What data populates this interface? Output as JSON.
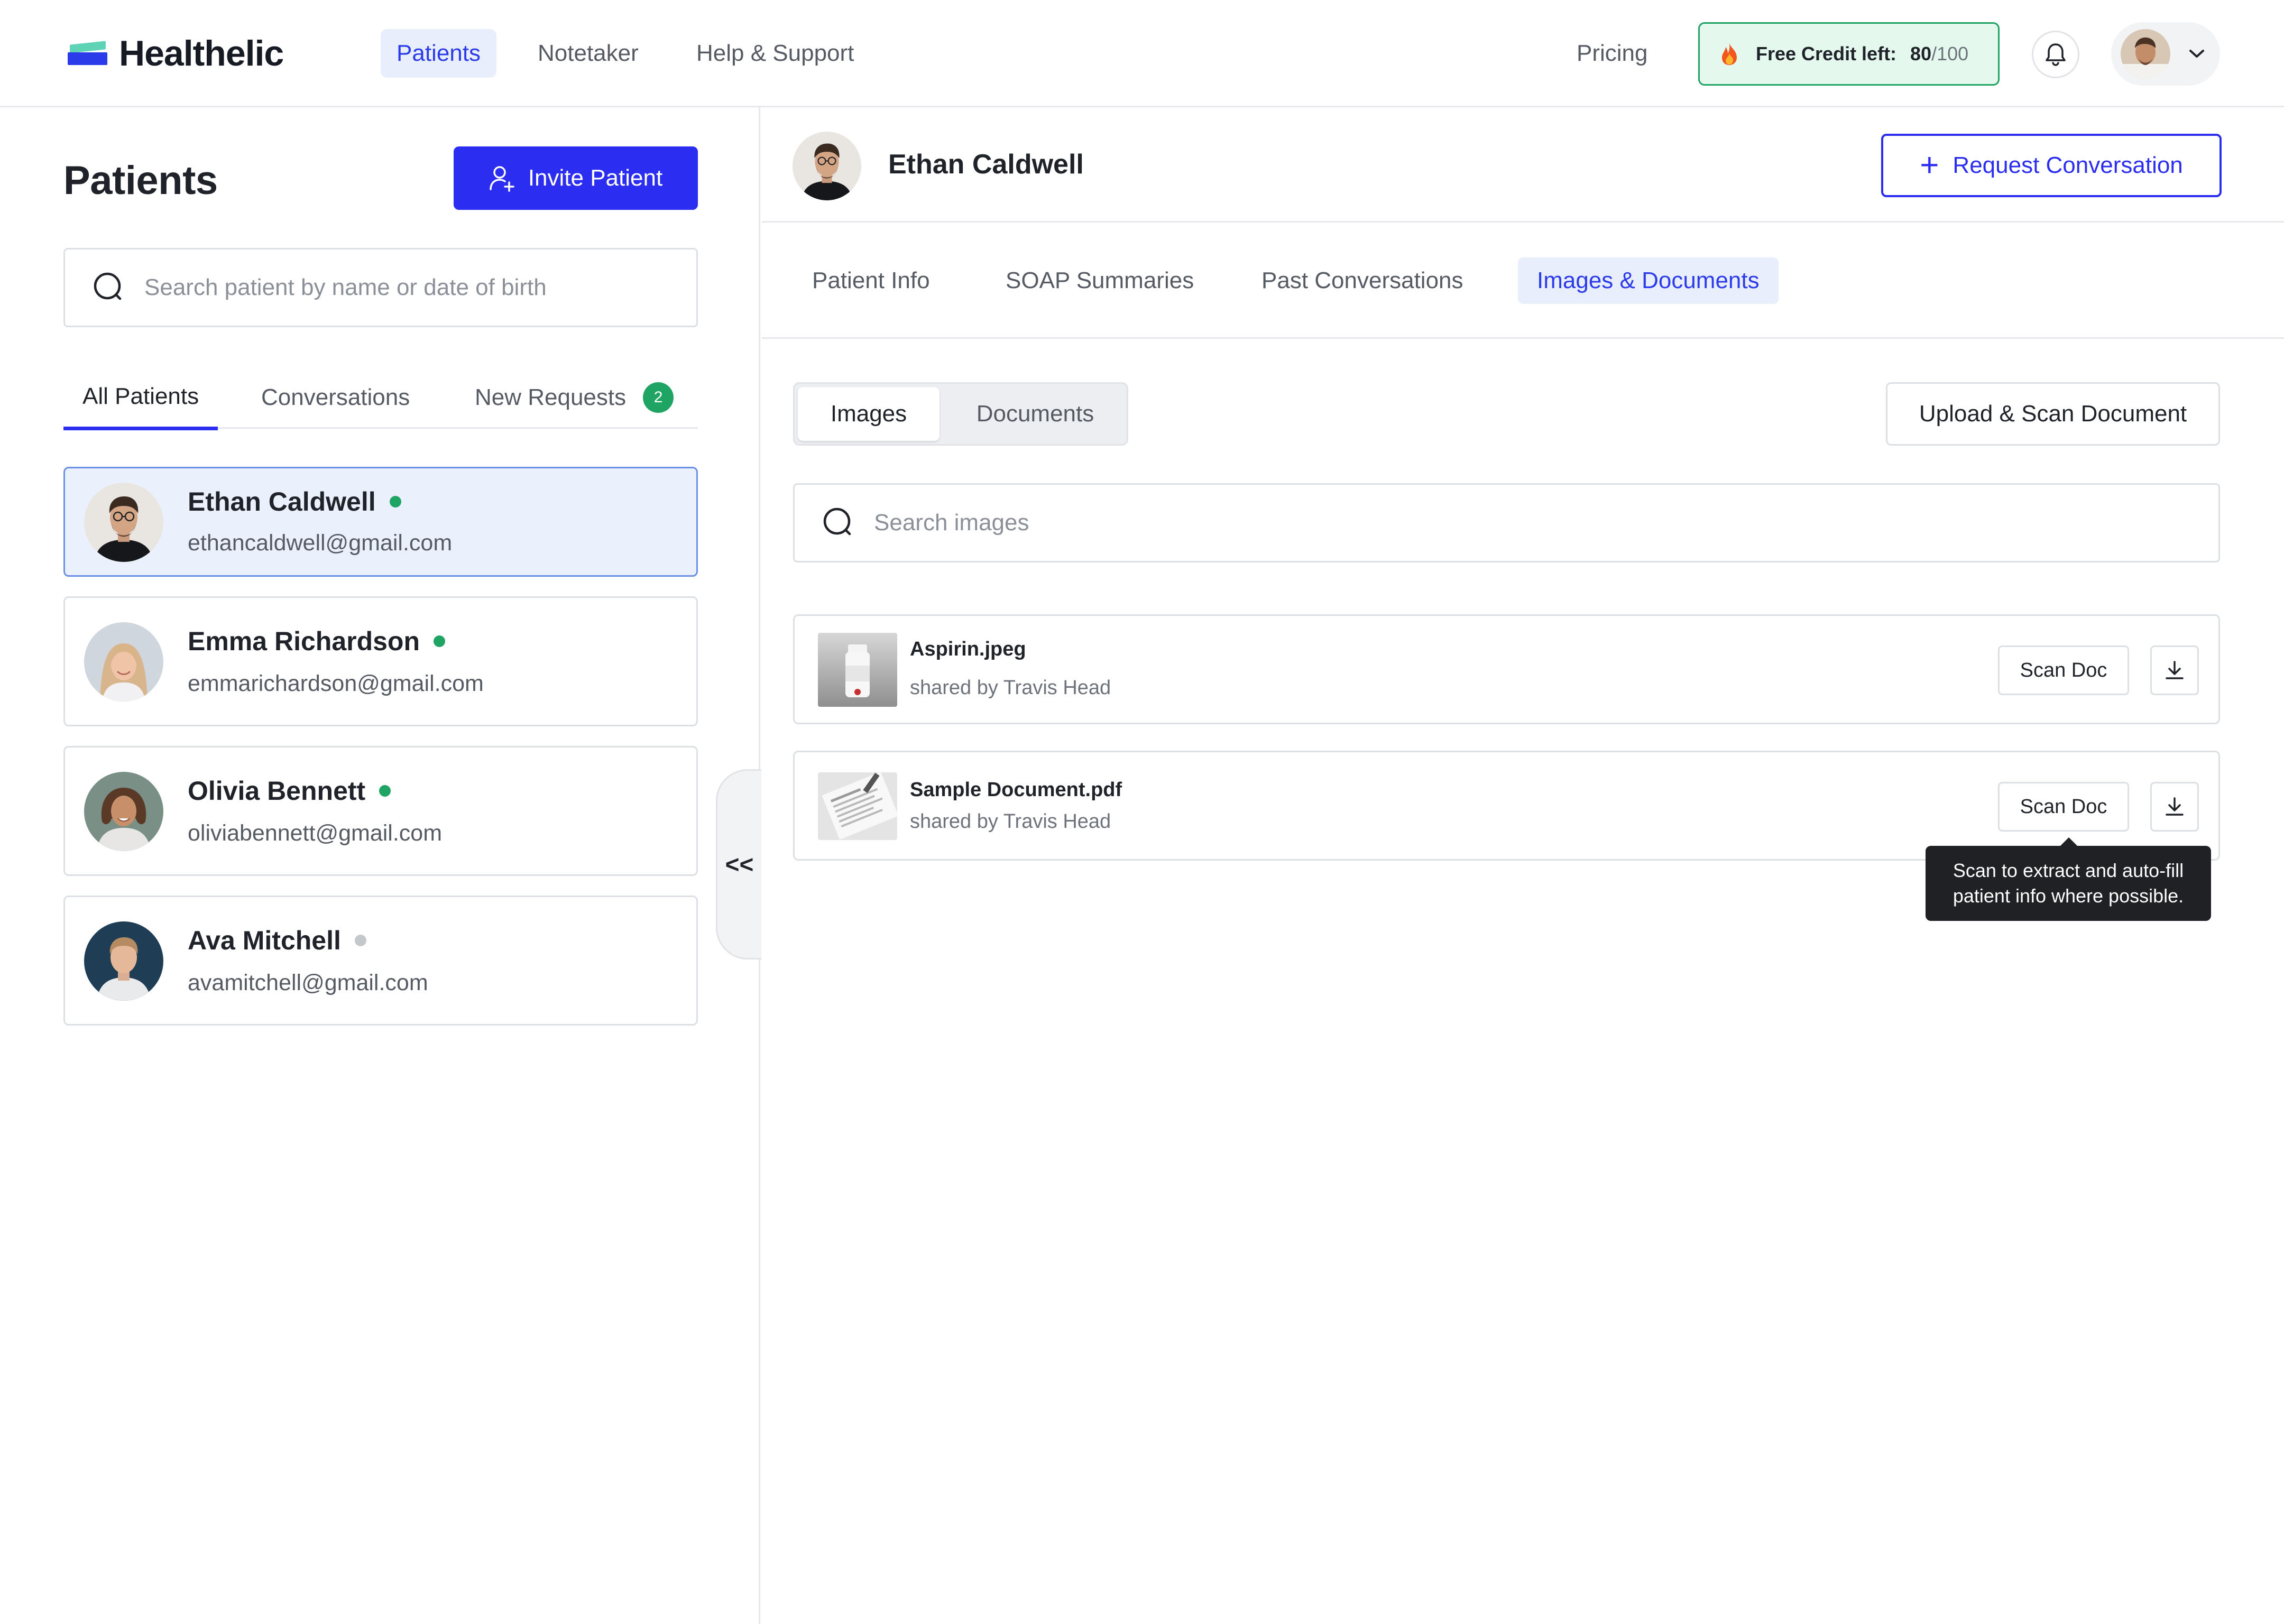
{
  "app": {
    "name": "Healthelic"
  },
  "nav": {
    "items": [
      {
        "label": "Patients",
        "active": true
      },
      {
        "label": "Notetaker",
        "active": false
      },
      {
        "label": "Help & Support",
        "active": false
      }
    ],
    "pricing": "Pricing",
    "credit": {
      "label": "Free Credit left:",
      "used": "80",
      "total": "/100"
    }
  },
  "patients_panel": {
    "title": "Patients",
    "invite_label": "Invite Patient",
    "search_placeholder": "Search patient by name or date of birth",
    "tabs": [
      {
        "label": "All Patients",
        "active": true
      },
      {
        "label": "Conversations",
        "active": false
      },
      {
        "label": "New Requests",
        "active": false,
        "badge": "2"
      }
    ],
    "list": [
      {
        "name": "Ethan Caldwell",
        "email": "ethancaldwell@gmail.com",
        "online": true,
        "selected": true
      },
      {
        "name": "Emma Richardson",
        "email": "emmarichardson@gmail.com",
        "online": true,
        "selected": false
      },
      {
        "name": "Olivia Bennett",
        "email": "oliviabennett@gmail.com",
        "online": true,
        "selected": false
      },
      {
        "name": "Ava Mitchell",
        "email": "avamitchell@gmail.com",
        "online": false,
        "selected": false
      }
    ],
    "collapse_glyph": "<<"
  },
  "detail": {
    "patient_name": "Ethan Caldwell",
    "request_label": "Request Conversation",
    "tabs": [
      {
        "label": "Patient Info",
        "active": false
      },
      {
        "label": "SOAP Summaries",
        "active": false
      },
      {
        "label": "Past Conversations",
        "active": false
      },
      {
        "label": "Images & Documents",
        "active": true
      }
    ],
    "segments": [
      {
        "label": "Images",
        "active": true
      },
      {
        "label": "Documents",
        "active": false
      }
    ],
    "upload_label": "Upload & Scan Document",
    "search_placeholder": "Search images",
    "files": [
      {
        "name": "Aspirin.jpeg",
        "shared_by": "shared by Travis Head",
        "scan_label": "Scan Doc"
      },
      {
        "name": "Sample Document.pdf",
        "shared_by": "shared by Travis Head",
        "scan_label": "Scan Doc"
      }
    ],
    "tooltip": {
      "line1": "Scan to extract and auto-fill",
      "line2": "patient info where possible."
    }
  },
  "colors": {
    "accent": "#2b2ef0",
    "accent_soft": "#e8eefc",
    "online": "#1fa463",
    "offline": "#c4c7cc",
    "credit_bg": "#e5f8ee"
  },
  "icons": [
    "logo-mark",
    "fire-icon",
    "bell-icon",
    "chevron-down-icon",
    "user-plus-icon",
    "search-icon",
    "plus-icon",
    "download-icon",
    "collapse-icon"
  ]
}
